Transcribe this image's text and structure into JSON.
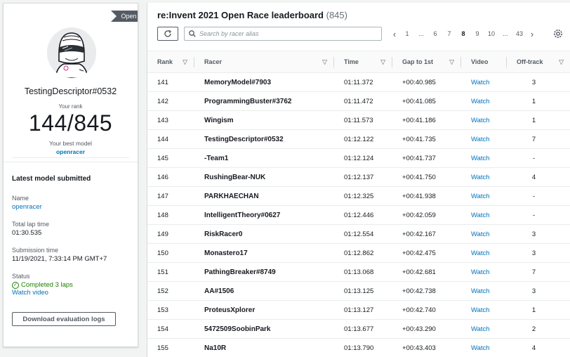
{
  "profile": {
    "open_badge": "Open",
    "racer_name": "TestingDescriptor#0532",
    "rank_label": "Your rank",
    "rank_value": "144/845",
    "best_model_label": "Your best model",
    "best_model": "openracer"
  },
  "latest": {
    "section_title": "Latest model submitted",
    "name_label": "Name",
    "name_value": "openracer",
    "lap_label": "Total lap time",
    "lap_value": "01:30.535",
    "submission_label": "Submission time",
    "submission_value": "11/19/2021, 7:33:14 PM GMT+7",
    "status_label": "Status",
    "status_value": "Completed 3 laps",
    "watch_video": "Watch video",
    "download_button": "Download evaluation logs"
  },
  "board": {
    "title": "re:Invent 2021 Open Race leaderboard",
    "count": "(845)",
    "search_placeholder": "Search by racer alias",
    "pagination": {
      "first": "1",
      "ellipsis_left": "...",
      "p6": "6",
      "p7": "7",
      "p8": "8",
      "p9": "9",
      "p10": "10",
      "ellipsis_right": "...",
      "last": "43",
      "active_page": "8"
    },
    "columns": [
      "Rank",
      "Racer",
      "Time",
      "Gap to 1st",
      "Video",
      "Off-track"
    ],
    "rows": [
      {
        "rank": "141",
        "racer": "MemoryModel#7903",
        "time": "01:11.372",
        "gap": "+00:40.985",
        "video": "Watch",
        "offtrack": "3"
      },
      {
        "rank": "142",
        "racer": "ProgrammingBuster#3762",
        "time": "01:11.472",
        "gap": "+00:41.085",
        "video": "Watch",
        "offtrack": "1"
      },
      {
        "rank": "143",
        "racer": "Wingism",
        "time": "01:11.573",
        "gap": "+00:41.186",
        "video": "Watch",
        "offtrack": "1"
      },
      {
        "rank": "144",
        "racer": "TestingDescriptor#0532",
        "time": "01:12.122",
        "gap": "+00:41.735",
        "video": "Watch",
        "offtrack": "7"
      },
      {
        "rank": "145",
        "racer": "-Team1",
        "time": "01:12.124",
        "gap": "+00:41.737",
        "video": "Watch",
        "offtrack": "-"
      },
      {
        "rank": "146",
        "racer": "RushingBear-NUK",
        "time": "01:12.137",
        "gap": "+00:41.750",
        "video": "Watch",
        "offtrack": "4"
      },
      {
        "rank": "147",
        "racer": "PARKHAECHAN",
        "time": "01:12.325",
        "gap": "+00:41.938",
        "video": "Watch",
        "offtrack": "-"
      },
      {
        "rank": "148",
        "racer": "IntelligentTheory#0627",
        "time": "01:12.446",
        "gap": "+00:42.059",
        "video": "Watch",
        "offtrack": "-"
      },
      {
        "rank": "149",
        "racer": "RiskRacer0",
        "time": "01:12.554",
        "gap": "+00:42.167",
        "video": "Watch",
        "offtrack": "3"
      },
      {
        "rank": "150",
        "racer": "Monastero17",
        "time": "01:12.862",
        "gap": "+00:42.475",
        "video": "Watch",
        "offtrack": "3"
      },
      {
        "rank": "151",
        "racer": "PathingBreaker#8749",
        "time": "01:13.068",
        "gap": "+00:42.681",
        "video": "Watch",
        "offtrack": "7"
      },
      {
        "rank": "152",
        "racer": "AA#1506",
        "time": "01:13.125",
        "gap": "+00:42.738",
        "video": "Watch",
        "offtrack": "3"
      },
      {
        "rank": "153",
        "racer": "ProteusXplorer",
        "time": "01:13.127",
        "gap": "+00:42.740",
        "video": "Watch",
        "offtrack": "1"
      },
      {
        "rank": "154",
        "racer": "5472509SoobinPark",
        "time": "01:13.677",
        "gap": "+00:43.290",
        "video": "Watch",
        "offtrack": "2"
      },
      {
        "rank": "155",
        "racer": "Na10R",
        "time": "01:13.790",
        "gap": "+00:43.403",
        "video": "Watch",
        "offtrack": "4"
      }
    ]
  },
  "colors": {
    "link": "#0073bb",
    "success": "#1d8102",
    "badge": "#545b64"
  },
  "icons": [
    "refresh-icon",
    "search-icon",
    "chevron-left-icon",
    "chevron-right-icon",
    "settings-icon",
    "sort-caret-icon",
    "check-circle-icon",
    "racer-avatar-icon"
  ]
}
